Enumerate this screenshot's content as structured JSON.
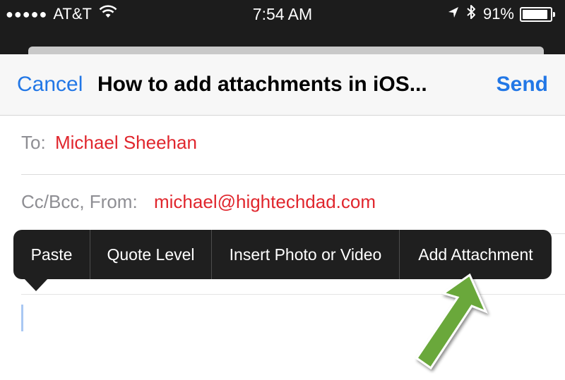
{
  "status_bar": {
    "signal": "●●●●●",
    "carrier": "AT&T",
    "time": "7:54 AM",
    "battery_percent": "91%",
    "battery_level": 0.91,
    "icons": [
      "wifi-icon",
      "location-icon",
      "bluetooth-icon",
      "battery-icon"
    ]
  },
  "nav": {
    "cancel_label": "Cancel",
    "title": "How to add attachments in iOS...",
    "send_label": "Send"
  },
  "fields": {
    "to_label": "To:",
    "to_value": "Michael Sheehan",
    "ccbcc_label": "Cc/Bcc, From:",
    "from_value": "michael@hightechdad.com"
  },
  "edit_menu": {
    "items": [
      "Paste",
      "Quote Level",
      "Insert Photo or Video",
      "Add Attachment"
    ]
  },
  "colors": {
    "accent": "#2277e6",
    "recipient": "#e0262d",
    "menu_bg": "#1f1f1f",
    "arrow": "#6aa83a"
  }
}
